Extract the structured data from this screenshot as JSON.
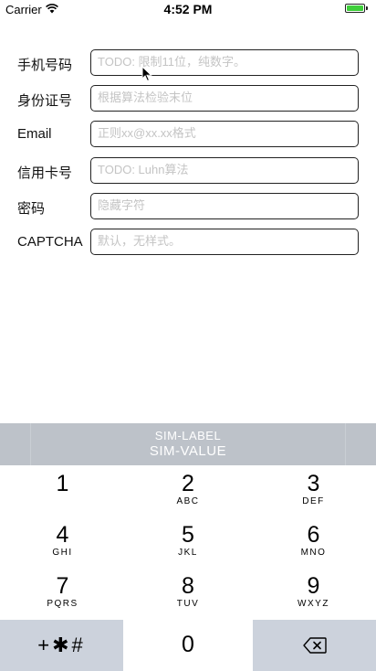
{
  "status_bar": {
    "carrier": "Carrier",
    "time": "4:52 PM",
    "battery_color": "#3fcf3b"
  },
  "form": {
    "rows": [
      {
        "label": "手机号码",
        "placeholder": "TODO: 限制11位，纯数字。"
      },
      {
        "label": "身份证号",
        "placeholder": "根据算法检验末位"
      },
      {
        "label": "Email",
        "placeholder": "正则xx@xx.xx格式"
      },
      {
        "label": "信用卡号",
        "placeholder": "TODO: Luhn算法"
      },
      {
        "label": "密码",
        "placeholder": "隐藏字符"
      },
      {
        "label": "CAPTCHA",
        "placeholder": "默认，无样式。"
      }
    ]
  },
  "keyboard": {
    "sim_label": "SIM-LABEL",
    "sim_value": "SIM-VALUE",
    "keys": [
      {
        "digit": "1",
        "letters": ""
      },
      {
        "digit": "2",
        "letters": "ABC"
      },
      {
        "digit": "3",
        "letters": "DEF"
      },
      {
        "digit": "4",
        "letters": "GHI"
      },
      {
        "digit": "5",
        "letters": "JKL"
      },
      {
        "digit": "6",
        "letters": "MNO"
      },
      {
        "digit": "7",
        "letters": "PQRS"
      },
      {
        "digit": "8",
        "letters": "TUV"
      },
      {
        "digit": "9",
        "letters": "WXYZ"
      }
    ],
    "symbols_key": "+✱#",
    "zero_key": "0",
    "delete_icon": "backspace-icon",
    "dark_key_color": "#ccd2dc",
    "sim_bar_color": "#bdc2c9"
  }
}
